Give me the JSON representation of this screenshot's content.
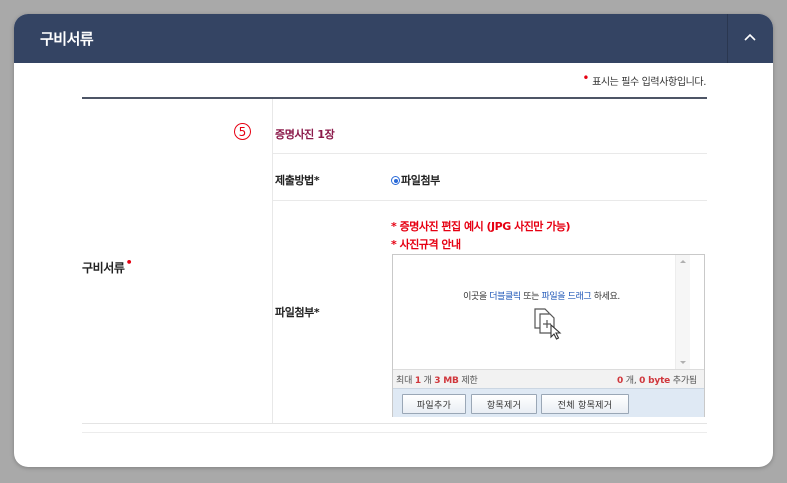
{
  "header": {
    "title": "구비서류",
    "collapse_icon": "chevron-up-icon"
  },
  "required_note": {
    "marker": "•",
    "text": "표시는 필수 입력사항입니다."
  },
  "section": {
    "label": "구비서류",
    "required_marker": "•"
  },
  "item": {
    "number": "5",
    "title": "증명사진 1장",
    "method": {
      "label": "제출방법*",
      "option": "파일첨부",
      "selected": true
    },
    "attach": {
      "label": "파일첨부*",
      "links": [
        "* 증명사진 편집 예시 (JPG 사진만 가능)",
        "* 사진규격 안내"
      ],
      "drop_zone": {
        "text_before": "이곳을 ",
        "highlight1": "더블클릭",
        "text_middle": " 또는 ",
        "highlight2": "파일을 드래그",
        "text_after": " 하세요."
      },
      "limits": {
        "prefix": "최대 ",
        "max_count": "1",
        "count_unit": " 개 ",
        "max_size": "3 MB",
        "suffix": " 제한"
      },
      "status": {
        "added_count": "0",
        "count_unit": " 개, ",
        "added_size": "0 byte",
        "suffix": " 추가됨"
      },
      "buttons": {
        "add": "파일추가",
        "remove": "항목제거",
        "remove_all": "전체 항목제거"
      }
    }
  },
  "colors": {
    "header_bg": "#344463",
    "required_red": "#e60012",
    "title_maroon": "#8b1a4a",
    "link_blue": "#2158b8"
  }
}
